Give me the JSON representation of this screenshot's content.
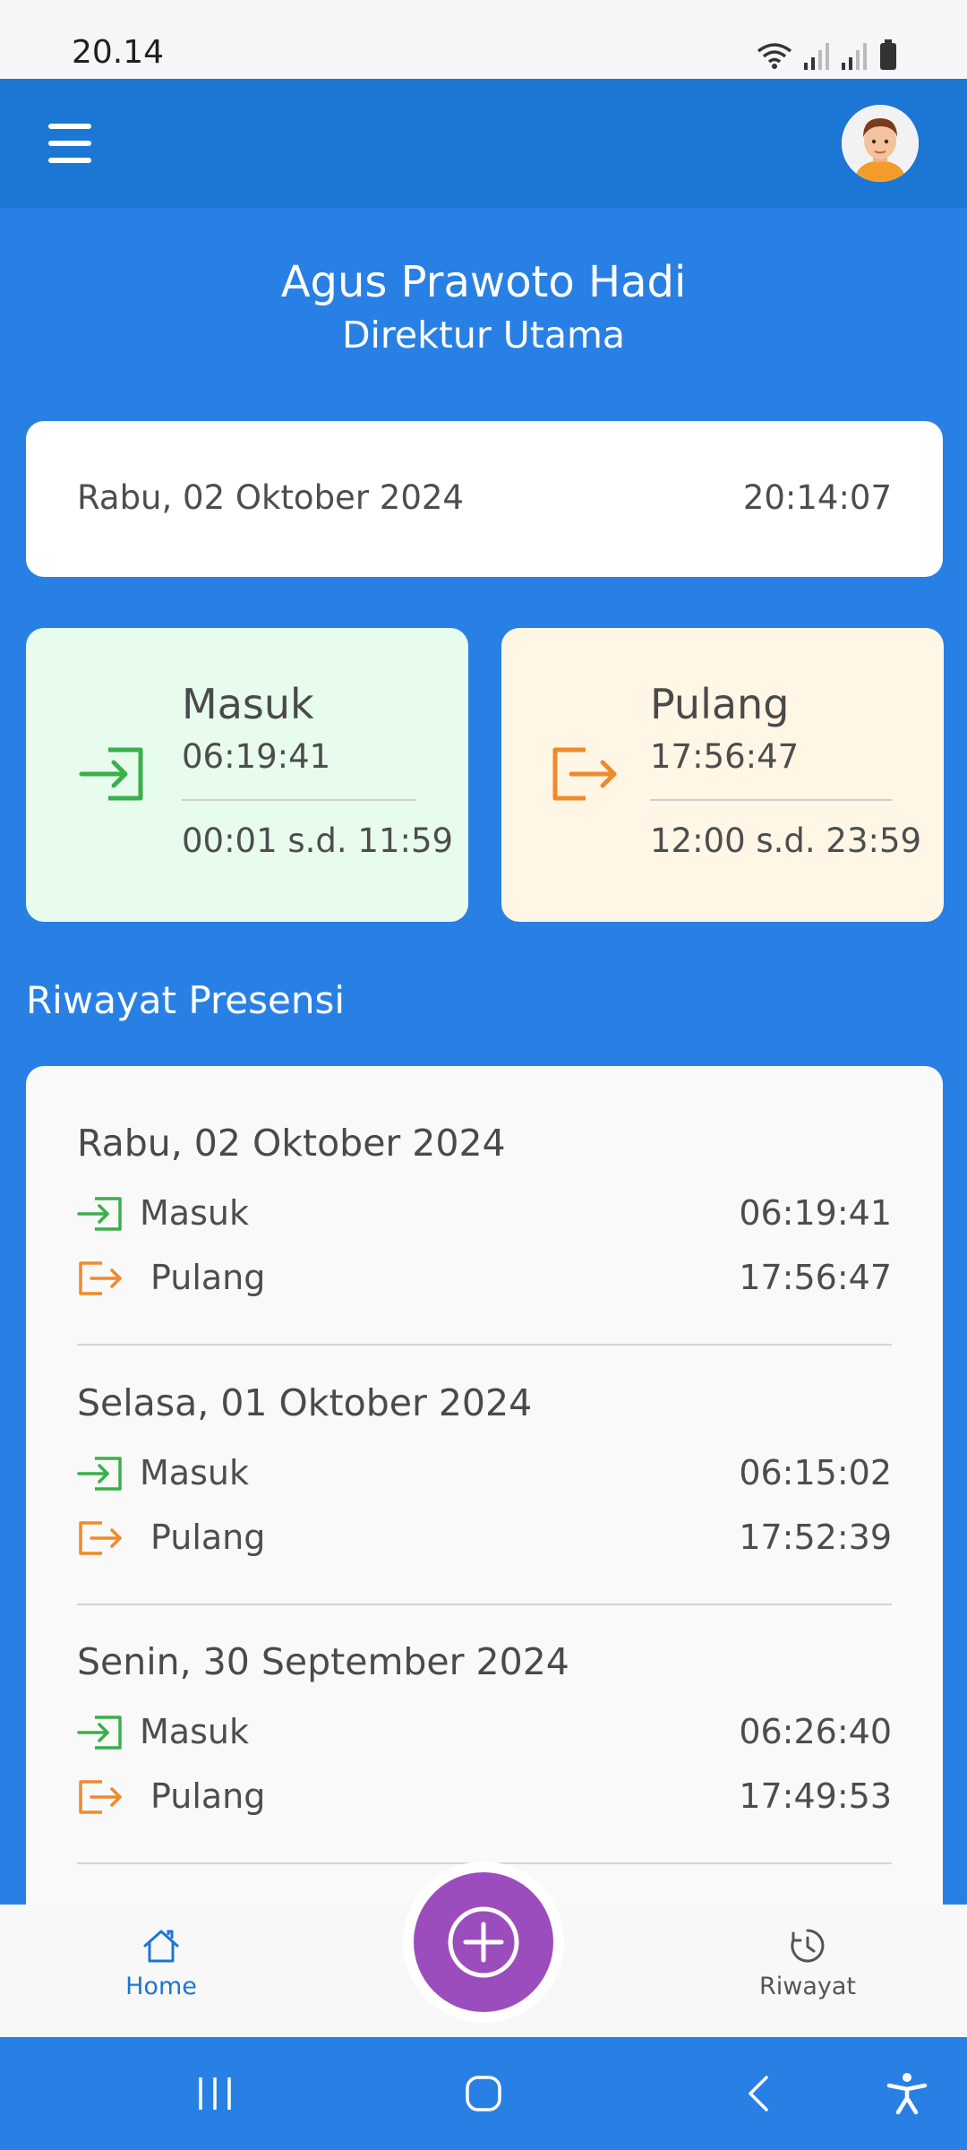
{
  "status_bar": {
    "time": "20.14"
  },
  "app_bar": {
    "menu_icon": "hamburger-menu-icon",
    "avatar": "user-avatar"
  },
  "user": {
    "name": "Agus Prawoto Hadi",
    "role": "Direktur Utama"
  },
  "today": {
    "date": "Rabu, 02 Oktober 2024",
    "clock": "20:14:07"
  },
  "check_in": {
    "title": "Masuk",
    "time": "06:19:41",
    "range": "00:01 s.d. 11:59",
    "color": "#3ab04a"
  },
  "check_out": {
    "title": "Pulang",
    "time": "17:56:47",
    "range": "12:00 s.d. 23:59",
    "color": "#ef8a2c"
  },
  "history": {
    "title": "Riwayat Presensi",
    "days": [
      {
        "date": "Rabu, 02 Oktober 2024",
        "in_label": "Masuk",
        "in_time": "06:19:41",
        "out_label": "Pulang",
        "out_time": "17:56:47"
      },
      {
        "date": "Selasa, 01 Oktober 2024",
        "in_label": "Masuk",
        "in_time": "06:15:02",
        "out_label": "Pulang",
        "out_time": "17:52:39"
      },
      {
        "date": "Senin, 30 September 2024",
        "in_label": "Masuk",
        "in_time": "06:26:40",
        "out_label": "Pulang",
        "out_time": "17:49:53"
      }
    ]
  },
  "bottom_nav": {
    "home_label": "Home",
    "history_label": "Riwayat",
    "active": "Home"
  },
  "colors": {
    "primary": "#2980e4",
    "app_bar": "#1c76d3",
    "fab": "#9c4dbd"
  }
}
